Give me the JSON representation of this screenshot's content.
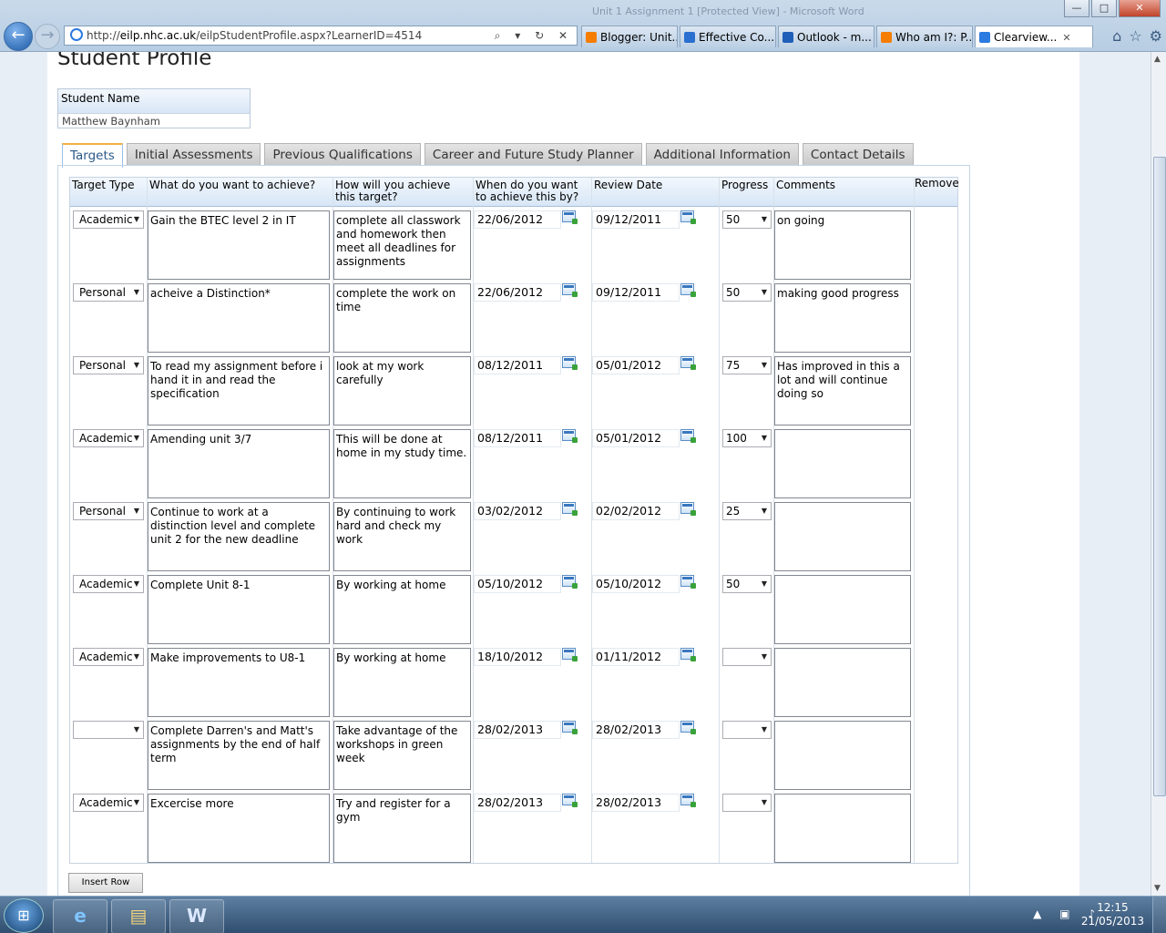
{
  "browser": {
    "url_prefix": "http://",
    "url_host": "eilp.nhc.ac.uk",
    "url_path": "/eilpStudentProfile.aspx?LearnerID=4514",
    "url_tools": "⌕ ▾ ↻ ✕",
    "back_glyph": "←",
    "forward_glyph": "→",
    "background_window": "Unit 1 Assignment 1 [Protected View] - Microsoft Word",
    "tabs": [
      {
        "label": "Blogger: Unit...",
        "icon": "blogger-icon",
        "color": "#f57d00"
      },
      {
        "label": "Effective Co...",
        "icon": "shield-icon",
        "color": "#2a6fd0"
      },
      {
        "label": "Outlook - m...",
        "icon": "outlook-icon",
        "color": "#1f5fb8"
      },
      {
        "label": "Who am I?: P...",
        "icon": "blogger-icon",
        "color": "#f57d00"
      },
      {
        "label": "Clearview...",
        "icon": "ie-icon",
        "color": "#2b7be0"
      }
    ],
    "tab_close": "✕",
    "commands": [
      "⌂",
      "☆",
      "⚙"
    ],
    "window_controls": {
      "minimize": "—",
      "maximize": "□",
      "close": "✕"
    }
  },
  "page": {
    "title": "Student Profile",
    "student_name_label": "Student Name",
    "student_name_value": "Matthew Baynham",
    "tabs": [
      "Targets",
      "Initial Assessments",
      "Previous Qualifications",
      "Career and Future Study Planner",
      "Additional Information",
      "Contact Details"
    ],
    "active_tab": "Targets",
    "columns": {
      "type": "Target Type",
      "what": "What do you want to achieve?",
      "how": "How will you achieve this target?",
      "when": "When do you want to achieve this by?",
      "review": "Review Date",
      "progress": "Progress",
      "comments": "Comments",
      "remove": "Remove"
    },
    "rows": [
      {
        "type": "Academic",
        "what": "Gain the BTEC level 2 in IT",
        "how": "complete all classwork and homework then meet all deadlines for assignments",
        "when": "22/06/2012",
        "review": "09/12/2011",
        "progress": "50",
        "comments": "on going"
      },
      {
        "type": "Personal",
        "what": "acheive a Distinction*",
        "how": "complete the work on time",
        "when": "22/06/2012",
        "review": "09/12/2011",
        "progress": "50",
        "comments": "making good progress"
      },
      {
        "type": "Personal",
        "what": "To read my assignment before i hand it in and read the specification",
        "how": "look at my work carefully",
        "when": "08/12/2011",
        "review": "05/01/2012",
        "progress": "75",
        "comments": "Has improved in this a lot and will continue doing so"
      },
      {
        "type": "Academic",
        "what": "Amending unit 3/7",
        "how": "This will be done at home in my study time.",
        "when": "08/12/2011",
        "review": "05/01/2012",
        "progress": "100",
        "comments": ""
      },
      {
        "type": "Personal",
        "what": "Continue to work at a distinction level and complete unit 2 for the new deadline",
        "how": "By continuing to work hard and check my work",
        "when": "03/02/2012",
        "review": "02/02/2012",
        "progress": "25",
        "comments": ""
      },
      {
        "type": "Academic",
        "what": "Complete Unit 8-1",
        "how": "By working at home",
        "when": "05/10/2012",
        "review": "05/10/2012",
        "progress": "50",
        "comments": ""
      },
      {
        "type": "Academic",
        "what": "Make improvements to U8-1",
        "how": "By working at home",
        "when": "18/10/2012",
        "review": "01/11/2012",
        "progress": "",
        "comments": ""
      },
      {
        "type": "",
        "what": "Complete Darren's and Matt's assignments by the end of half term",
        "how": "Take advantage of the workshops in green week",
        "when": "28/02/2013",
        "review": "28/02/2013",
        "progress": "",
        "comments": ""
      },
      {
        "type": "Academic",
        "what": "Excercise more",
        "how": "Try and register for a gym",
        "when": "28/02/2013",
        "review": "28/02/2013",
        "progress": "",
        "comments": ""
      }
    ],
    "insert_row_label": "Insert Row"
  },
  "taskbar": {
    "start_glyph": "⊞",
    "apps": [
      {
        "name": "internet-explorer",
        "glyph": "e"
      },
      {
        "name": "file-explorer",
        "glyph": "▤"
      },
      {
        "name": "word",
        "glyph": "W"
      }
    ],
    "tray_icons": "▲ ▣ ♪",
    "time": "12:15",
    "date": "21/05/2013"
  }
}
